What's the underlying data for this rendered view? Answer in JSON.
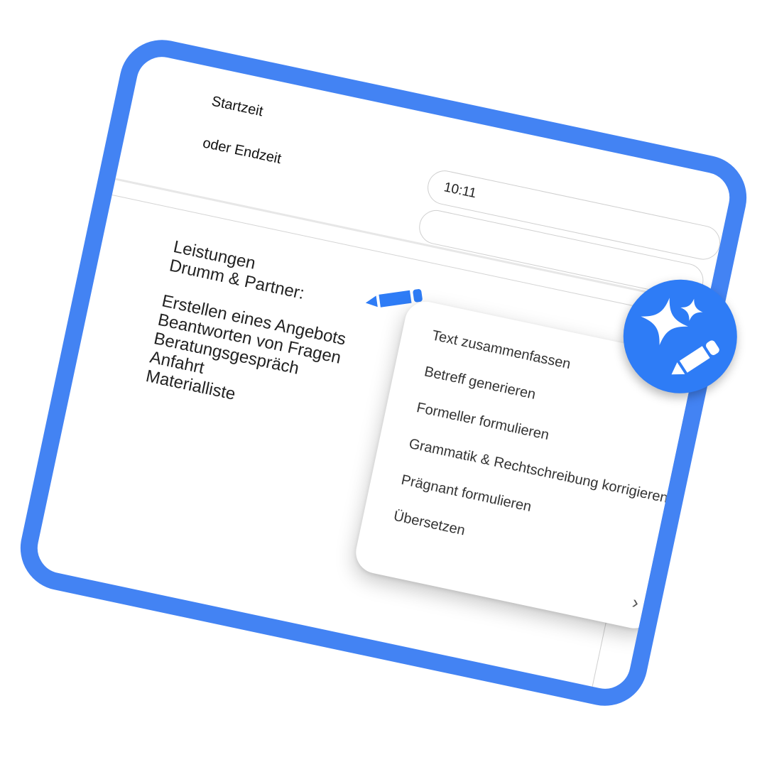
{
  "form": {
    "start_label": "Startzeit",
    "end_label": "oder Endzeit",
    "start_value": "10:11",
    "end_value": ""
  },
  "services": {
    "heading_line1": "Leistungen",
    "heading_line2": "Drumm & Partner:",
    "items": [
      "Erstellen eines Angebots",
      "Beantworten von Fragen",
      "Beratungsgespräch",
      "Anfahrt",
      "Materialliste"
    ]
  },
  "ai_menu": {
    "items": [
      "Text zusammenfassen",
      "Betreff generieren",
      "Formeller formulieren",
      "Grammatik & Rechtschreibung korrigieren",
      "Prägnant formulieren",
      "Übersetzen"
    ],
    "more_glyph": "›"
  },
  "icons": {
    "edit": "pencil-icon",
    "ai": "sparkles-pencil-icon"
  },
  "colors": {
    "accent": "#4383f3",
    "ai_button": "#2e7cf6"
  }
}
